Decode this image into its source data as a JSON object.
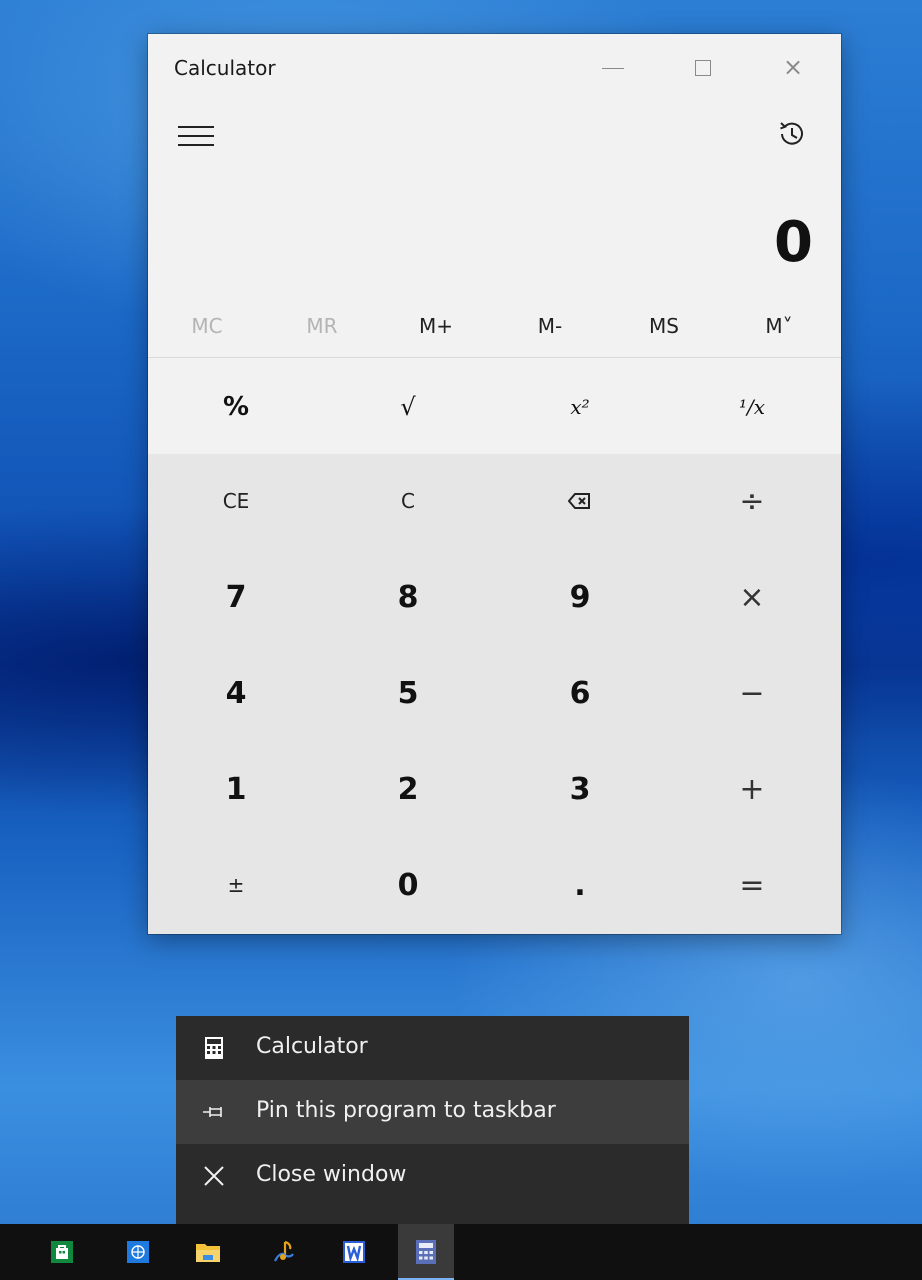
{
  "window": {
    "title": "Calculator",
    "minimize": "minimize-button",
    "maximize": "maximize-button",
    "close": "×"
  },
  "display": {
    "value": "0"
  },
  "memory": [
    "MC",
    "MR",
    "M+",
    "M-",
    "MS",
    "M˅"
  ],
  "scientific": [
    {
      "label": "%",
      "name": "percent-button"
    },
    {
      "label": "√",
      "name": "sqrt-button"
    },
    {
      "label": "x²",
      "name": "square-button"
    },
    {
      "label": "¹/x",
      "name": "reciprocal-button"
    }
  ],
  "keys": [
    [
      "CE",
      "C",
      "⌫",
      "÷"
    ],
    [
      "7",
      "8",
      "9",
      "×"
    ],
    [
      "4",
      "5",
      "6",
      "−"
    ],
    [
      "1",
      "2",
      "3",
      "+"
    ],
    [
      "±",
      "0",
      ".",
      "="
    ]
  ],
  "jumplist": {
    "items": [
      {
        "label": "Calculator",
        "icon": "calculator-icon"
      },
      {
        "label": "Pin this program to taskbar",
        "icon": "pin-icon"
      },
      {
        "label": "Close window",
        "icon": "close-icon"
      }
    ]
  },
  "taskbar": {
    "apps": [
      "store-icon",
      "browser-icon",
      "file-explorer-icon",
      "app-icon",
      "word-icon",
      "calculator-icon"
    ],
    "active": "calculator-icon"
  },
  "colors": {
    "window_bg": "#f2f2f2",
    "keypad_bg": "#e6e6e6",
    "jumplist_bg": "#2b2b2b",
    "taskbar_bg": "#101010"
  }
}
